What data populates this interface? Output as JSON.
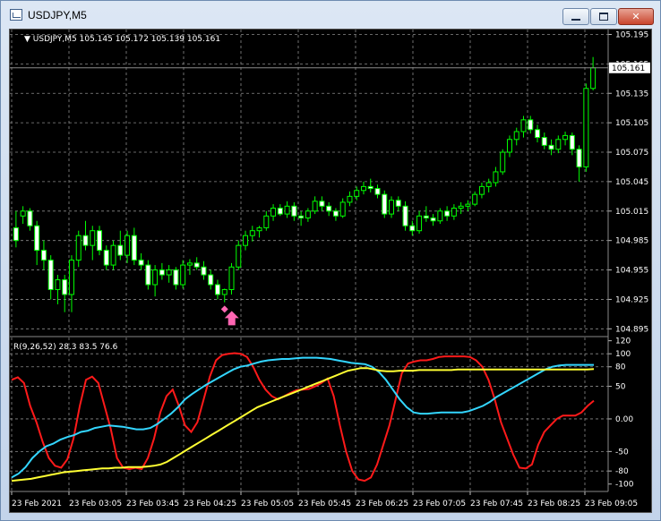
{
  "window": {
    "title": "USDJPY,M5",
    "minimize_glyph": "minimize-icon",
    "maximize_glyph": "maximize-icon",
    "close_glyph": "✕"
  },
  "main_chart": {
    "header": "USDJPY,M5  105.145 105.172 105.139 105.161",
    "current_price_label": "105.161",
    "y_ticks": [
      "105.195",
      "105.165",
      "105.135",
      "105.105",
      "105.075",
      "105.045",
      "105.015",
      "104.985",
      "104.955",
      "104.925",
      "104.895"
    ],
    "colors": {
      "background": "#000000",
      "candle": "#00ff00",
      "grid": "#8a8a8a",
      "price_line": "#8a8a8a"
    },
    "arrow_signal_color": "#ff66b3"
  },
  "indicator": {
    "header": "R(9,26,52) 28.3 83.5 76.6",
    "y_ticks": [
      "120",
      "100",
      "80",
      "50",
      "0.00",
      "-50",
      "-80",
      "-100"
    ],
    "colors": {
      "fast": "#ff1a1a",
      "medium": "#33d6ff",
      "slow": "#ffff33"
    }
  },
  "x_ticks": [
    "23 Feb 2021",
    "23 Feb 03:05",
    "23 Feb 03:45",
    "23 Feb 04:25",
    "23 Feb 05:05",
    "23 Feb 05:45",
    "23 Feb 06:25",
    "23 Feb 07:05",
    "23 Feb 07:45",
    "23 Feb 08:25",
    "23 Feb 09:05"
  ],
  "chart_data": [
    {
      "type": "candlestick",
      "title": "USDJPY,M5",
      "ylim": [
        104.888,
        105.2
      ],
      "ohlc": [
        [
          104.998,
          105.015,
          104.978,
          104.985
        ],
        [
          105.01,
          105.02,
          105.002,
          105.015
        ],
        [
          105.015,
          105.018,
          104.995,
          105.0
        ],
        [
          105.0,
          105.005,
          104.96,
          104.975
        ],
        [
          104.975,
          104.985,
          104.955,
          104.965
        ],
        [
          104.965,
          104.97,
          104.925,
          104.935
        ],
        [
          104.935,
          104.95,
          104.92,
          104.945
        ],
        [
          104.945,
          104.95,
          104.912,
          104.93
        ],
        [
          104.93,
          104.97,
          104.912,
          104.965
        ],
        [
          104.965,
          104.995,
          104.958,
          104.99
        ],
        [
          104.99,
          105.005,
          104.975,
          104.98
        ],
        [
          104.98,
          105.0,
          104.965,
          104.995
        ],
        [
          104.995,
          105.0,
          104.97,
          104.975
        ],
        [
          104.975,
          104.98,
          104.955,
          104.96
        ],
        [
          104.96,
          104.985,
          104.955,
          104.98
        ],
        [
          104.98,
          104.995,
          104.965,
          104.97
        ],
        [
          104.97,
          104.995,
          104.962,
          104.99
        ],
        [
          104.99,
          104.998,
          104.96,
          104.965
        ],
        [
          104.965,
          104.972,
          104.955,
          104.96
        ],
        [
          104.96,
          104.965,
          104.935,
          104.94
        ],
        [
          104.94,
          104.96,
          104.928,
          104.955
        ],
        [
          104.955,
          104.962,
          104.945,
          104.95
        ],
        [
          104.95,
          104.96,
          104.942,
          104.955
        ],
        [
          104.955,
          104.958,
          104.935,
          104.94
        ],
        [
          104.94,
          104.965,
          104.936,
          104.96
        ],
        [
          104.96,
          104.966,
          104.95,
          104.962
        ],
        [
          104.962,
          104.968,
          104.955,
          104.958
        ],
        [
          104.958,
          104.964,
          104.945,
          104.95
        ],
        [
          104.95,
          104.955,
          104.935,
          104.94
        ],
        [
          104.94,
          104.945,
          104.925,
          104.93
        ],
        [
          104.93,
          104.936,
          104.922,
          104.935
        ],
        [
          104.935,
          104.962,
          104.93,
          104.958
        ],
        [
          104.958,
          104.985,
          104.955,
          104.98
        ],
        [
          104.98,
          104.995,
          104.975,
          104.99
        ],
        [
          104.99,
          105.0,
          104.984,
          104.995
        ],
        [
          104.995,
          105.0,
          104.988,
          104.998
        ],
        [
          104.998,
          105.015,
          104.995,
          105.01
        ],
        [
          105.01,
          105.022,
          105.005,
          105.018
        ],
        [
          105.018,
          105.022,
          105.01,
          105.012
        ],
        [
          105.012,
          105.025,
          105.008,
          105.02
        ],
        [
          105.02,
          105.024,
          105.005,
          105.01
        ],
        [
          105.01,
          105.015,
          105.0,
          105.008
        ],
        [
          105.008,
          105.018,
          105.004,
          105.015
        ],
        [
          105.015,
          105.03,
          105.012,
          105.025
        ],
        [
          105.025,
          105.03,
          105.015,
          105.02
        ],
        [
          105.02,
          105.024,
          105.01,
          105.015
        ],
        [
          105.015,
          105.018,
          105.005,
          105.01
        ],
        [
          105.01,
          105.028,
          105.008,
          105.024
        ],
        [
          105.024,
          105.035,
          105.02,
          105.03
        ],
        [
          105.03,
          105.04,
          105.026,
          105.036
        ],
        [
          105.036,
          105.045,
          105.032,
          105.04
        ],
        [
          105.04,
          105.048,
          105.034,
          105.038
        ],
        [
          105.038,
          105.042,
          105.028,
          105.032
        ],
        [
          105.032,
          105.036,
          105.008,
          105.012
        ],
        [
          105.012,
          105.03,
          105.008,
          105.026
        ],
        [
          105.026,
          105.03,
          105.015,
          105.02
        ],
        [
          105.02,
          105.025,
          104.995,
          105.0
        ],
        [
          105.0,
          105.005,
          104.99,
          104.995
        ],
        [
          104.995,
          105.015,
          104.992,
          105.01
        ],
        [
          105.01,
          105.02,
          105.004,
          105.008
        ],
        [
          105.008,
          105.012,
          105.0,
          105.005
        ],
        [
          105.005,
          105.018,
          105.002,
          105.015
        ],
        [
          105.015,
          105.02,
          105.005,
          105.01
        ],
        [
          105.01,
          105.022,
          105.006,
          105.018
        ],
        [
          105.018,
          105.024,
          105.012,
          105.02
        ],
        [
          105.02,
          105.026,
          105.015,
          105.022
        ],
        [
          105.022,
          105.035,
          105.02,
          105.032
        ],
        [
          105.032,
          105.044,
          105.028,
          105.04
        ],
        [
          105.04,
          105.048,
          105.034,
          105.044
        ],
        [
          105.044,
          105.06,
          105.04,
          105.055
        ],
        [
          105.055,
          105.078,
          105.052,
          105.075
        ],
        [
          105.075,
          105.092,
          105.07,
          105.088
        ],
        [
          105.088,
          105.1,
          105.082,
          105.096
        ],
        [
          105.096,
          105.112,
          105.09,
          105.108
        ],
        [
          105.108,
          105.112,
          105.094,
          105.098
        ],
        [
          105.098,
          105.103,
          105.085,
          105.09
        ],
        [
          105.09,
          105.095,
          105.078,
          105.082
        ],
        [
          105.082,
          105.088,
          105.072,
          105.078
        ],
        [
          105.078,
          105.092,
          105.074,
          105.088
        ],
        [
          105.088,
          105.096,
          105.082,
          105.092
        ],
        [
          105.092,
          105.095,
          105.072,
          105.078
        ],
        [
          105.078,
          105.082,
          105.045,
          105.06
        ],
        [
          105.06,
          105.145,
          105.055,
          105.14
        ],
        [
          105.14,
          105.172,
          105.138,
          105.161
        ]
      ]
    },
    {
      "type": "line",
      "title": "R(9,26,52)",
      "ylim": [
        -110,
        125
      ],
      "series": [
        {
          "name": "",
          "values": [
            60,
            64,
            55,
            20,
            -5,
            -35,
            -60,
            -72,
            -75,
            -62,
            -30,
            20,
            60,
            65,
            55,
            20,
            -15,
            -60,
            -75,
            -77,
            -75,
            -77,
            -60,
            -30,
            10,
            35,
            45,
            20,
            -10,
            -20,
            -5,
            30,
            65,
            90,
            98,
            100,
            101,
            100,
            95,
            80,
            60,
            45,
            35,
            30,
            35,
            40,
            44,
            45,
            46,
            50,
            55,
            62,
            35,
            -10,
            -50,
            -80,
            -93,
            -95,
            -90,
            -70,
            -40,
            -10,
            30,
            70,
            85,
            88,
            90,
            90,
            92,
            95,
            96,
            96,
            96,
            96,
            95,
            90,
            80,
            60,
            30,
            -5,
            -30,
            -55,
            -75,
            -76,
            -70,
            -40,
            -20,
            -10,
            0,
            5,
            5,
            5,
            10,
            20,
            28
          ]
        },
        {
          "name": "",
          "values": [
            -90,
            -84,
            -74,
            -60,
            -50,
            -42,
            -38,
            -32,
            -28,
            -25,
            -20,
            -18,
            -14,
            -12,
            -10,
            -11,
            -12,
            -14,
            -16,
            -16,
            -14,
            -8,
            0,
            8,
            18,
            30,
            38,
            45,
            52,
            58,
            64,
            70,
            76,
            80,
            82,
            85,
            88,
            90,
            91,
            92,
            92,
            93,
            94,
            94,
            94,
            93,
            92,
            90,
            88,
            86,
            85,
            84,
            80,
            72,
            60,
            45,
            30,
            18,
            10,
            8,
            8,
            9,
            10,
            10,
            10,
            10,
            12,
            16,
            20,
            26,
            34,
            40,
            46,
            52,
            58,
            64,
            70,
            76,
            80,
            82,
            83,
            83,
            83,
            83,
            83
          ]
        },
        {
          "name": "",
          "values": [
            -95,
            -94,
            -93,
            -92,
            -90,
            -88,
            -86,
            -84,
            -82,
            -81,
            -80,
            -79,
            -78,
            -77,
            -76,
            -76,
            -75,
            -75,
            -74,
            -74,
            -74,
            -73,
            -72,
            -70,
            -66,
            -60,
            -54,
            -48,
            -42,
            -36,
            -30,
            -24,
            -18,
            -12,
            -6,
            0,
            6,
            12,
            18,
            22,
            26,
            30,
            34,
            38,
            42,
            46,
            50,
            54,
            58,
            62,
            66,
            70,
            74,
            76,
            78,
            78,
            76,
            74,
            73,
            73,
            74,
            74,
            74,
            75,
            75,
            75,
            75,
            75,
            75,
            76,
            76,
            76,
            76,
            76,
            76,
            76,
            76,
            76,
            76,
            76,
            76,
            76,
            76,
            76,
            76,
            76,
            76,
            76,
            76,
            76,
            76.6
          ]
        }
      ]
    }
  ]
}
